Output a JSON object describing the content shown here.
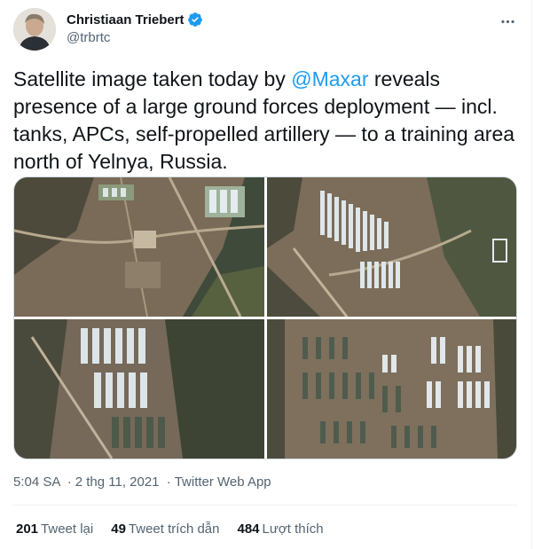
{
  "author": {
    "name": "Christiaan Triebert",
    "handle": "@trbrtc"
  },
  "tweet": {
    "text_before": "Satellite image taken today by ",
    "mention": "@Maxar",
    "text_after": " reveals presence of a large ground forces deployment — incl. tanks, APCs, self-propelled artillery — to a training area north of Yelnya, Russia."
  },
  "media": {
    "images": [
      {
        "icon": "satellite-image"
      },
      {
        "icon": "satellite-image"
      },
      {
        "icon": "satellite-image"
      },
      {
        "icon": "satellite-image"
      }
    ]
  },
  "meta": {
    "time": "5:04 SA",
    "date": "2 thg 11, 2021",
    "separator": "·",
    "source": "Twitter Web App"
  },
  "stats": {
    "retweets": {
      "count": "201",
      "label": "Tweet lại"
    },
    "quotes": {
      "count": "49",
      "label": "Tweet trích dẫn"
    },
    "likes": {
      "count": "484",
      "label": "Lượt thích"
    }
  },
  "colors": {
    "link": "#1d9bf0",
    "verified": "#1d9bf0",
    "secondary_text": "#536471"
  }
}
